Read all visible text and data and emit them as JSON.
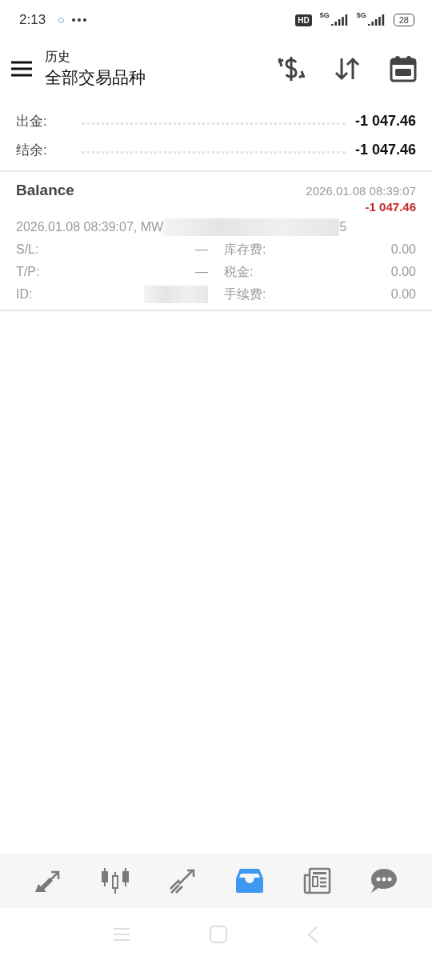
{
  "status_bar": {
    "time": "2:13",
    "hd": "HD",
    "signal_1": "5G",
    "signal_2": "5G",
    "battery": "28"
  },
  "toolbar": {
    "subtitle": "历史",
    "title": "全部交易品种"
  },
  "summary": [
    {
      "label": "出金:",
      "value": "-1 047.46"
    },
    {
      "label": "结余:",
      "value": "-1 047.46"
    }
  ],
  "deal": {
    "type": "Balance",
    "time": "2026.01.08 08:39:07",
    "amount": "-1 047.46",
    "comment": "2026.01.08 08:39:07, MW",
    "comment_end": "5",
    "left": [
      {
        "label": "S/L:",
        "value": "—"
      },
      {
        "label": "T/P:",
        "value": "—"
      },
      {
        "label": "ID:"
      }
    ],
    "right": [
      {
        "label": "库存费:",
        "value": "0.00"
      },
      {
        "label": "税金:",
        "value": "0.00"
      },
      {
        "label": "手续费:",
        "value": "0.00"
      }
    ]
  },
  "bottom_nav": [
    {
      "kind": "trade",
      "selected": false
    },
    {
      "kind": "chart",
      "selected": false
    },
    {
      "kind": "trend",
      "selected": false
    },
    {
      "kind": "history",
      "selected": true
    },
    {
      "kind": "news",
      "selected": false
    },
    {
      "kind": "chat",
      "selected": false
    }
  ]
}
